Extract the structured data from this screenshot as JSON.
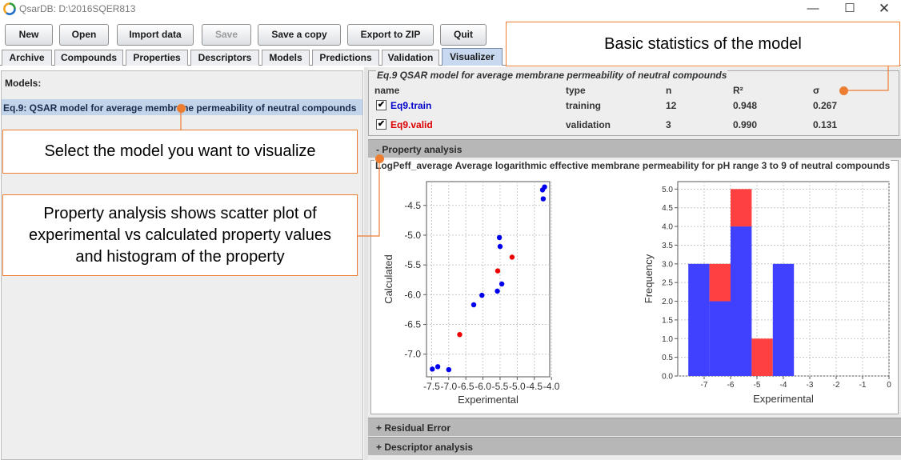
{
  "window": {
    "title": "QsarDB: D:\\2016SQER813"
  },
  "toolbar": {
    "new": "New",
    "open": "Open",
    "import": "Import data",
    "save": "Save",
    "save_copy": "Save a copy",
    "export_zip": "Export to ZIP",
    "quit": "Quit"
  },
  "tabs": [
    "Archive",
    "Compounds",
    "Properties",
    "Descriptors",
    "Models",
    "Predictions",
    "Validation",
    "Visualizer"
  ],
  "left": {
    "models_label": "Models:",
    "selected_model": "Eq.9: QSAR model for average membrane permeability of neutral compounds"
  },
  "stats": {
    "title": "Eq.9 QSAR model for average membrane permeability of neutral compounds",
    "headers": {
      "name": "name",
      "type": "type",
      "n": "n",
      "r2": "R²",
      "sigma": "σ"
    },
    "rows": [
      {
        "name": "Eq9.train",
        "type": "training",
        "n": "12",
        "r2": "0.948",
        "sigma": "0.267",
        "color": "#0000cc",
        "checked": "✔"
      },
      {
        "name": "Eq9.valid",
        "type": "validation",
        "n": "3",
        "r2": "0.990",
        "sigma": "0.131",
        "color": "#dd0000",
        "checked": "✔"
      }
    ]
  },
  "sections": {
    "property": "- Property analysis",
    "property_title": "LogPeff_average Average logarithmic effective membrane permeability for pH range 3 to 9 of neutral compounds",
    "residual": "+ Residual Error",
    "descriptor": "+ Descriptor analysis"
  },
  "annotations": {
    "basic_stats": "Basic statistics of the model",
    "select_model": "Select the model you want to visualize",
    "property_note": "Property analysis shows scatter plot of experimental vs calculated property values and histogram of the property"
  },
  "icons": {
    "app": "qsardb-logo-icon",
    "minimize": "minimize-icon",
    "maximize": "maximize-icon",
    "close": "close-icon",
    "checkbox": "checkbox-checked-icon"
  },
  "colors": {
    "accent": "#ed7d31",
    "train": "#0000ee",
    "valid": "#ee0000"
  },
  "chart_data": [
    {
      "type": "scatter",
      "title": "",
      "xlabel": "Experimental",
      "ylabel": "Calculated",
      "xlim": [
        -7.65,
        -4.05
      ],
      "ylim": [
        -7.38,
        -4.1
      ],
      "xticks": [
        -7.5,
        -7.0,
        -6.5,
        -6.0,
        -5.5,
        -5.0,
        -4.5,
        -4.0
      ],
      "xtick_labels": [
        "-7.5",
        "-7.0",
        "-6.5",
        "-6.0",
        "-5.5",
        "-5.0",
        "-4.5",
        "-4.0"
      ],
      "yticks": [
        -7.0,
        -6.5,
        -6.0,
        -5.5,
        -5.0,
        -4.5
      ],
      "ytick_labels": [
        "-7.0",
        "-6.5",
        "-6.0",
        "-5.5",
        "-5.0",
        "-4.5"
      ],
      "grid": true,
      "series": [
        {
          "color": "#0000ee",
          "x": [
            -7.48,
            -7.32,
            -7.0,
            -6.27,
            -6.03,
            -5.58,
            -5.52,
            -5.5,
            -5.45,
            -4.26,
            -4.2,
            -4.24
          ],
          "y": [
            -7.25,
            -7.21,
            -7.26,
            -6.17,
            -6.01,
            -5.94,
            -5.04,
            -5.19,
            -5.82,
            -4.24,
            -4.19,
            -4.39
          ]
        },
        {
          "color": "#ee0000",
          "x": [
            -6.68,
            -5.57,
            -5.15
          ],
          "y": [
            -6.67,
            -5.6,
            -5.37
          ]
        }
      ]
    },
    {
      "type": "bar",
      "title": "",
      "xlabel": "Experimental",
      "ylabel": "Frequency",
      "xlim": [
        -8.0,
        0.0
      ],
      "ylim": [
        0.0,
        5.2
      ],
      "xticks": [
        -7,
        -6,
        -5,
        -4,
        -3,
        -2,
        -1,
        0
      ],
      "xtick_labels": [
        "-7",
        "-6",
        "-5",
        "-4",
        "-3",
        "-2",
        "-1",
        "0"
      ],
      "yticks": [
        0.0,
        0.5,
        1.0,
        1.5,
        2.0,
        2.5,
        3.0,
        3.5,
        4.0,
        4.5,
        5.0
      ],
      "ytick_labels": [
        "0.0",
        "0.5",
        "1.0",
        "1.5",
        "2.0",
        "2.5",
        "3.0",
        "3.5",
        "4.0",
        "4.5",
        "5.0"
      ],
      "grid": true,
      "stacked": true,
      "bin_edges": [
        -7.6,
        -6.8,
        -6.0,
        -5.2,
        -4.4,
        -3.6
      ],
      "series": [
        {
          "color": "#4040ff",
          "values": [
            3,
            2,
            4,
            0,
            3
          ]
        },
        {
          "color": "#ff4040",
          "values": [
            0,
            1,
            1,
            1,
            0
          ]
        }
      ]
    }
  ]
}
